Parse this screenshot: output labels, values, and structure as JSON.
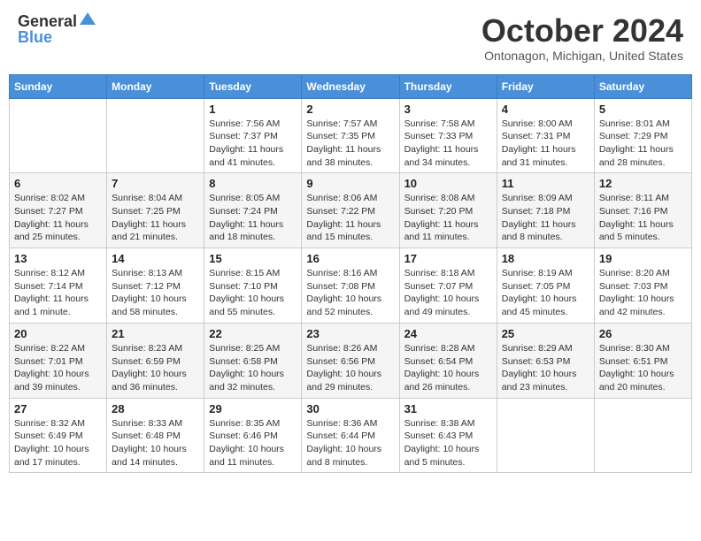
{
  "header": {
    "logo_general": "General",
    "logo_blue": "Blue",
    "title": "October 2024",
    "location": "Ontonagon, Michigan, United States"
  },
  "days_of_week": [
    "Sunday",
    "Monday",
    "Tuesday",
    "Wednesday",
    "Thursday",
    "Friday",
    "Saturday"
  ],
  "weeks": [
    [
      {
        "day": "",
        "info": ""
      },
      {
        "day": "",
        "info": ""
      },
      {
        "day": "1",
        "info": "Sunrise: 7:56 AM\nSunset: 7:37 PM\nDaylight: 11 hours and 41 minutes."
      },
      {
        "day": "2",
        "info": "Sunrise: 7:57 AM\nSunset: 7:35 PM\nDaylight: 11 hours and 38 minutes."
      },
      {
        "day": "3",
        "info": "Sunrise: 7:58 AM\nSunset: 7:33 PM\nDaylight: 11 hours and 34 minutes."
      },
      {
        "day": "4",
        "info": "Sunrise: 8:00 AM\nSunset: 7:31 PM\nDaylight: 11 hours and 31 minutes."
      },
      {
        "day": "5",
        "info": "Sunrise: 8:01 AM\nSunset: 7:29 PM\nDaylight: 11 hours and 28 minutes."
      }
    ],
    [
      {
        "day": "6",
        "info": "Sunrise: 8:02 AM\nSunset: 7:27 PM\nDaylight: 11 hours and 25 minutes."
      },
      {
        "day": "7",
        "info": "Sunrise: 8:04 AM\nSunset: 7:25 PM\nDaylight: 11 hours and 21 minutes."
      },
      {
        "day": "8",
        "info": "Sunrise: 8:05 AM\nSunset: 7:24 PM\nDaylight: 11 hours and 18 minutes."
      },
      {
        "day": "9",
        "info": "Sunrise: 8:06 AM\nSunset: 7:22 PM\nDaylight: 11 hours and 15 minutes."
      },
      {
        "day": "10",
        "info": "Sunrise: 8:08 AM\nSunset: 7:20 PM\nDaylight: 11 hours and 11 minutes."
      },
      {
        "day": "11",
        "info": "Sunrise: 8:09 AM\nSunset: 7:18 PM\nDaylight: 11 hours and 8 minutes."
      },
      {
        "day": "12",
        "info": "Sunrise: 8:11 AM\nSunset: 7:16 PM\nDaylight: 11 hours and 5 minutes."
      }
    ],
    [
      {
        "day": "13",
        "info": "Sunrise: 8:12 AM\nSunset: 7:14 PM\nDaylight: 11 hours and 1 minute."
      },
      {
        "day": "14",
        "info": "Sunrise: 8:13 AM\nSunset: 7:12 PM\nDaylight: 10 hours and 58 minutes."
      },
      {
        "day": "15",
        "info": "Sunrise: 8:15 AM\nSunset: 7:10 PM\nDaylight: 10 hours and 55 minutes."
      },
      {
        "day": "16",
        "info": "Sunrise: 8:16 AM\nSunset: 7:08 PM\nDaylight: 10 hours and 52 minutes."
      },
      {
        "day": "17",
        "info": "Sunrise: 8:18 AM\nSunset: 7:07 PM\nDaylight: 10 hours and 49 minutes."
      },
      {
        "day": "18",
        "info": "Sunrise: 8:19 AM\nSunset: 7:05 PM\nDaylight: 10 hours and 45 minutes."
      },
      {
        "day": "19",
        "info": "Sunrise: 8:20 AM\nSunset: 7:03 PM\nDaylight: 10 hours and 42 minutes."
      }
    ],
    [
      {
        "day": "20",
        "info": "Sunrise: 8:22 AM\nSunset: 7:01 PM\nDaylight: 10 hours and 39 minutes."
      },
      {
        "day": "21",
        "info": "Sunrise: 8:23 AM\nSunset: 6:59 PM\nDaylight: 10 hours and 36 minutes."
      },
      {
        "day": "22",
        "info": "Sunrise: 8:25 AM\nSunset: 6:58 PM\nDaylight: 10 hours and 32 minutes."
      },
      {
        "day": "23",
        "info": "Sunrise: 8:26 AM\nSunset: 6:56 PM\nDaylight: 10 hours and 29 minutes."
      },
      {
        "day": "24",
        "info": "Sunrise: 8:28 AM\nSunset: 6:54 PM\nDaylight: 10 hours and 26 minutes."
      },
      {
        "day": "25",
        "info": "Sunrise: 8:29 AM\nSunset: 6:53 PM\nDaylight: 10 hours and 23 minutes."
      },
      {
        "day": "26",
        "info": "Sunrise: 8:30 AM\nSunset: 6:51 PM\nDaylight: 10 hours and 20 minutes."
      }
    ],
    [
      {
        "day": "27",
        "info": "Sunrise: 8:32 AM\nSunset: 6:49 PM\nDaylight: 10 hours and 17 minutes."
      },
      {
        "day": "28",
        "info": "Sunrise: 8:33 AM\nSunset: 6:48 PM\nDaylight: 10 hours and 14 minutes."
      },
      {
        "day": "29",
        "info": "Sunrise: 8:35 AM\nSunset: 6:46 PM\nDaylight: 10 hours and 11 minutes."
      },
      {
        "day": "30",
        "info": "Sunrise: 8:36 AM\nSunset: 6:44 PM\nDaylight: 10 hours and 8 minutes."
      },
      {
        "day": "31",
        "info": "Sunrise: 8:38 AM\nSunset: 6:43 PM\nDaylight: 10 hours and 5 minutes."
      },
      {
        "day": "",
        "info": ""
      },
      {
        "day": "",
        "info": ""
      }
    ]
  ]
}
